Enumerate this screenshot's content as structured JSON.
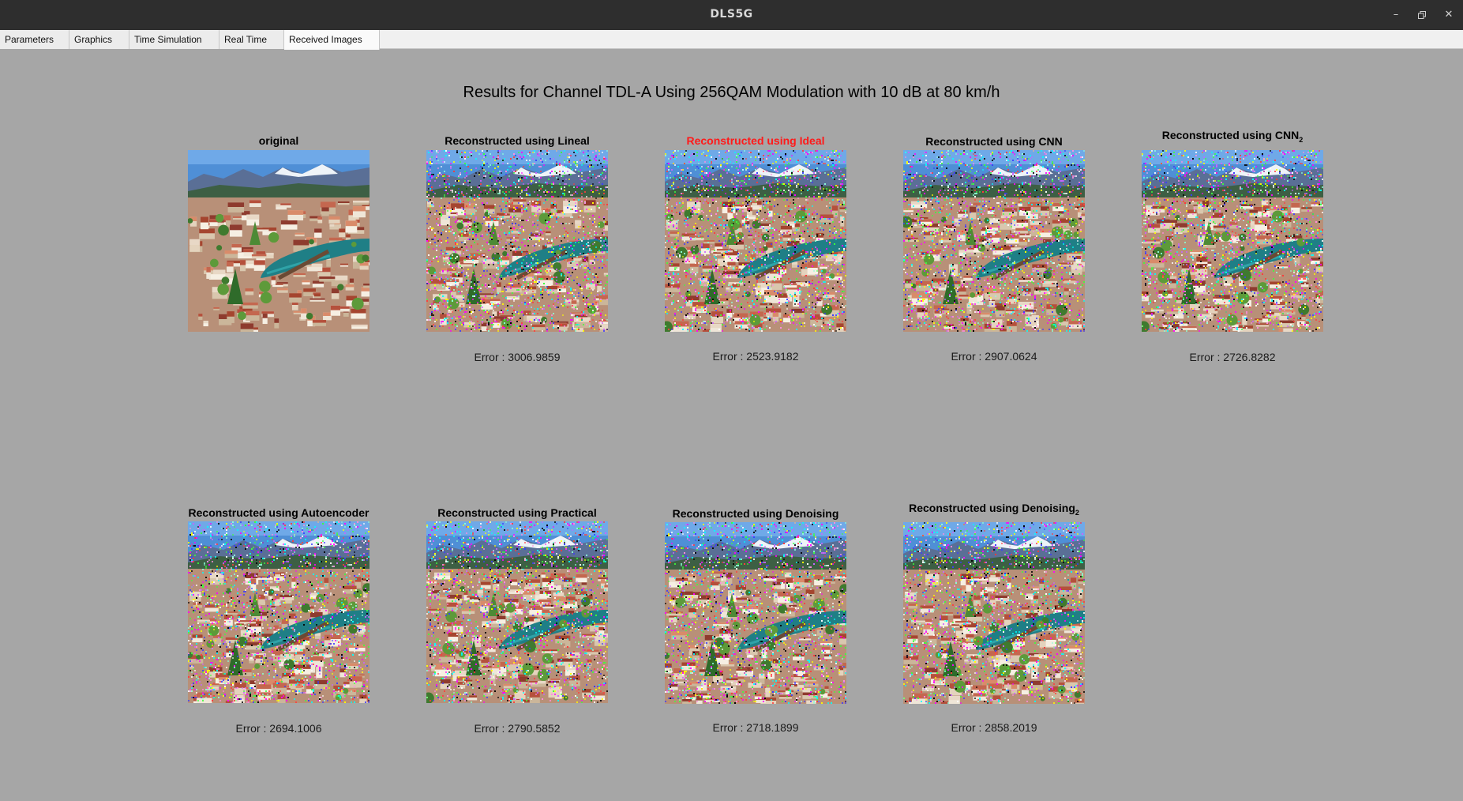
{
  "window": {
    "title": "DLS5G"
  },
  "tabs": [
    {
      "label": "Parameters"
    },
    {
      "label": "Graphics"
    },
    {
      "label": "Time Simulation"
    },
    {
      "label": "Real Time"
    },
    {
      "label": "Received Images"
    }
  ],
  "page_title": "Results for Channel TDL-A Using 256QAM Modulation with 10 dB at 80 km/h",
  "panels": [
    {
      "caption": "original",
      "error": ""
    },
    {
      "caption": "Reconstructed using Lineal",
      "error": "Error : 3006.9859"
    },
    {
      "caption": "Reconstructed using Ideal",
      "error": "Error : 2523.9182",
      "caption_color": "#ff1a1a"
    },
    {
      "caption": "Reconstructed using CNN",
      "error": "Error : 2907.0624"
    },
    {
      "caption": "Reconstructed using CNN",
      "caption_sub": "2",
      "error": "Error : 2726.8282"
    },
    {
      "caption": "Reconstructed using Autoencoder",
      "error": "Error : 2694.1006"
    },
    {
      "caption": "Reconstructed using Practical",
      "error": "Error : 2790.5852"
    },
    {
      "caption": "Reconstructed using Denoising",
      "error": "Error : 2718.1899"
    },
    {
      "caption": "Reconstructed using Denoising",
      "caption_sub": "2",
      "error": "Error : 2858.2019"
    }
  ],
  "icons": {
    "minimize": "minimize-icon",
    "restore": "restore-icon",
    "close": "close-icon"
  }
}
